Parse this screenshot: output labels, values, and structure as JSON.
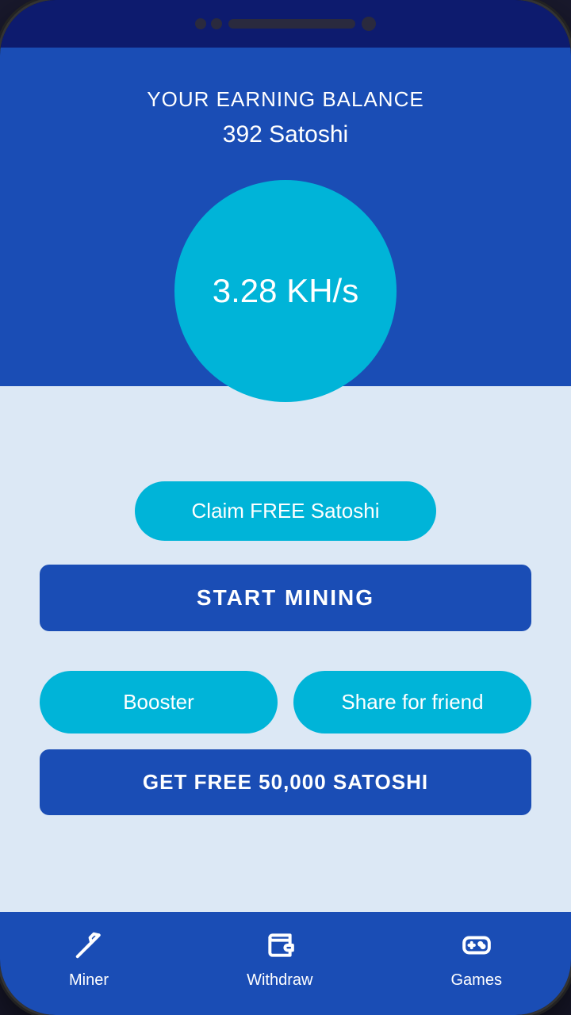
{
  "status_bar": {
    "speaker_visible": true
  },
  "top_section": {
    "bg_color": "#1a4db5",
    "earning_label": "YOUR EARNING BALANCE",
    "balance": "392 Satoshi",
    "hash_rate": "3.28 KH/s",
    "circle_color": "#00b4d8"
  },
  "buttons": {
    "claim_label": "Claim FREE Satoshi",
    "start_mining_label": "START MINING",
    "booster_label": "Booster",
    "share_label": "Share for friend",
    "free_satoshi_label": "GET FREE 50,000 SATOSHI"
  },
  "nav": {
    "items": [
      {
        "id": "miner",
        "label": "Miner",
        "icon": "pickaxe-icon"
      },
      {
        "id": "withdraw",
        "label": "Withdraw",
        "icon": "wallet-icon"
      },
      {
        "id": "games",
        "label": "Games",
        "icon": "gamepad-icon"
      }
    ]
  }
}
